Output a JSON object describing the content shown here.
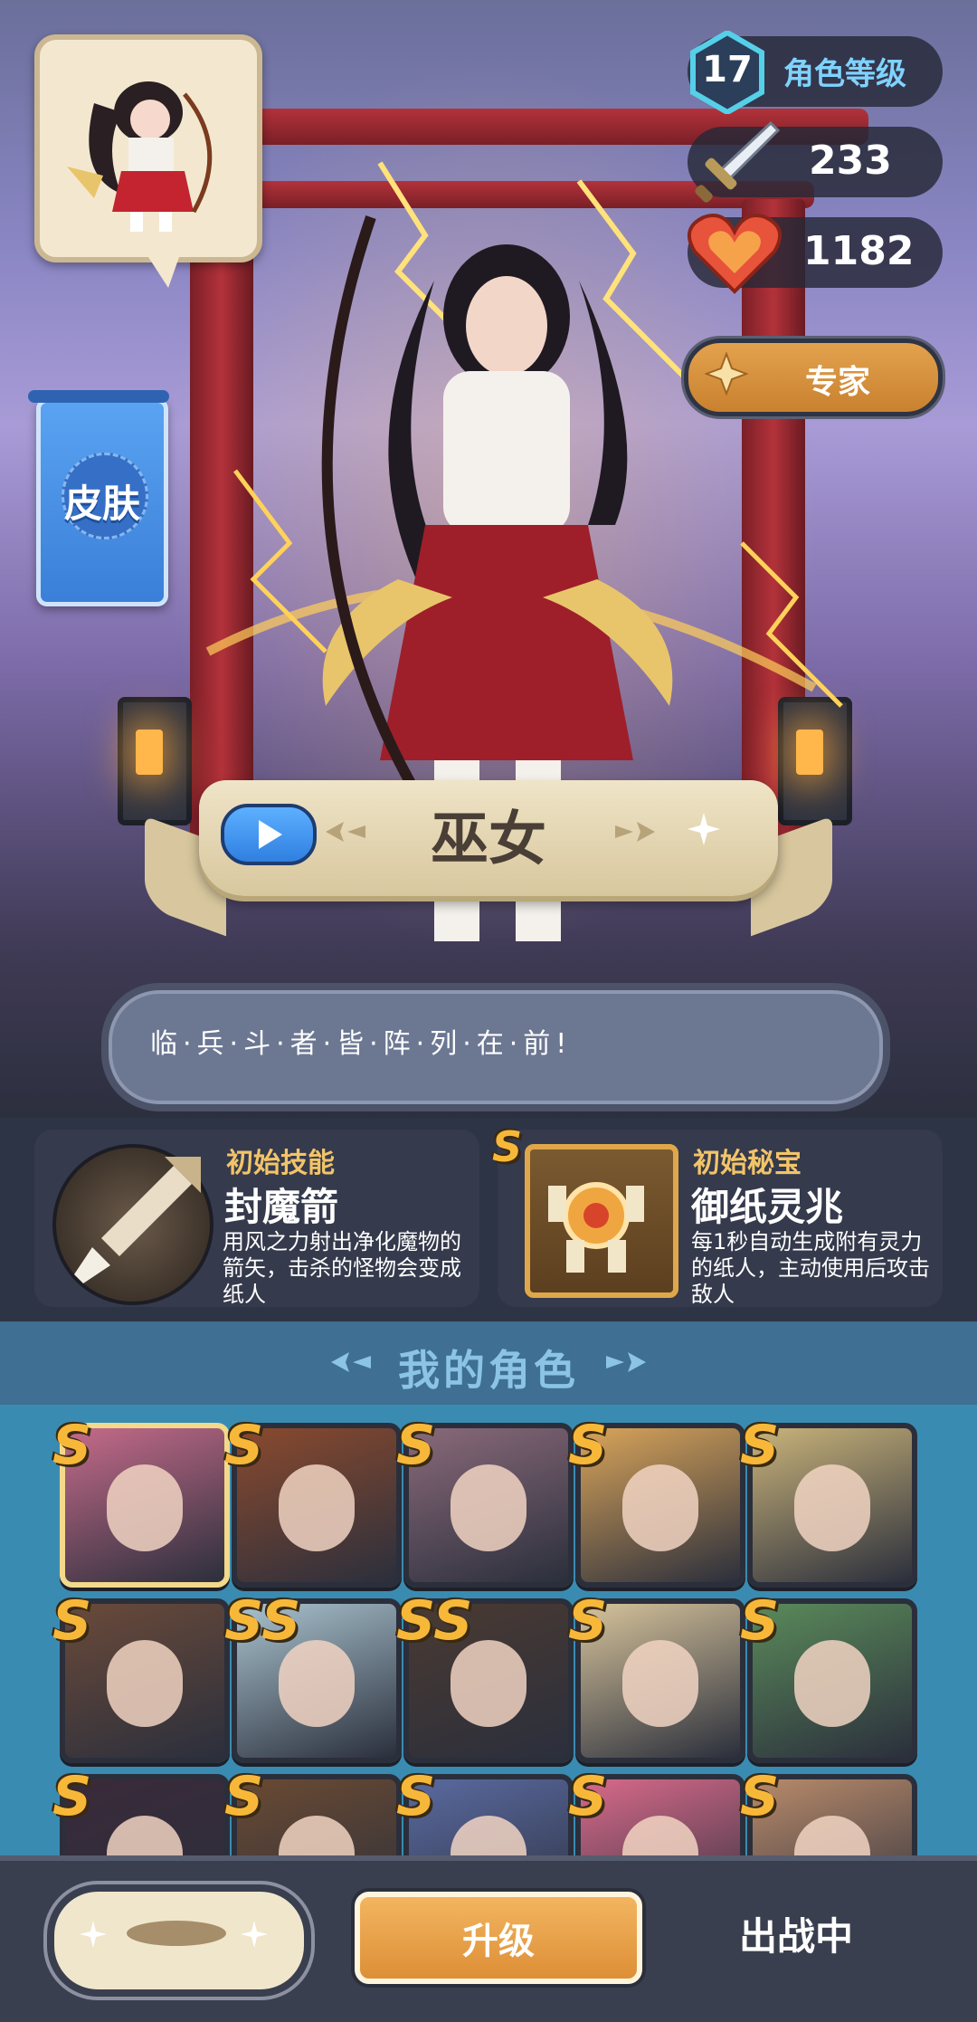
{
  "stats": {
    "level": "17",
    "level_label": "角色等级",
    "attack": "233",
    "hp": "1182",
    "rank_button": "专家"
  },
  "skin_button": "皮肤",
  "character": {
    "name": "巫女",
    "quote": "临·兵·斗·者·皆·阵·列·在·前!"
  },
  "initial_skill": {
    "section": "初始技能",
    "name": "封魔箭",
    "desc": "用风之力射出净化魔物的箭矢，击杀的怪物会变成纸人"
  },
  "initial_treasure": {
    "rank": "S",
    "section": "初始秘宝",
    "name": "御纸灵兆",
    "desc": "每1秒自动生成附有灵力的纸人，主动使用后攻击敌人"
  },
  "roles": {
    "title": "我的角色",
    "items": [
      {
        "rank": "S",
        "color": "#c56b8a",
        "selected": true
      },
      {
        "rank": "S",
        "color": "#8a4a2e"
      },
      {
        "rank": "S",
        "color": "#8a6a7a"
      },
      {
        "rank": "S",
        "color": "#d9a45a"
      },
      {
        "rank": "S",
        "color": "#c9b37a"
      },
      {
        "rank": "S",
        "color": "#6a4a3a"
      },
      {
        "rank": "SS",
        "color": "#a9c3cf"
      },
      {
        "rank": "SS",
        "color": "#4a3a32"
      },
      {
        "rank": "S",
        "color": "#d6c39b"
      },
      {
        "rank": "S",
        "color": "#5a8a5a"
      },
      {
        "rank": "S",
        "color": "#3a2a3a"
      },
      {
        "rank": "S",
        "color": "#6a4a32"
      },
      {
        "rank": "S",
        "color": "#5a6aa0"
      },
      {
        "rank": "S",
        "color": "#d86a8a"
      },
      {
        "rank": "S",
        "color": "#b88a6a"
      }
    ]
  },
  "bottom": {
    "upgrade": "升级",
    "status": "出战中"
  }
}
